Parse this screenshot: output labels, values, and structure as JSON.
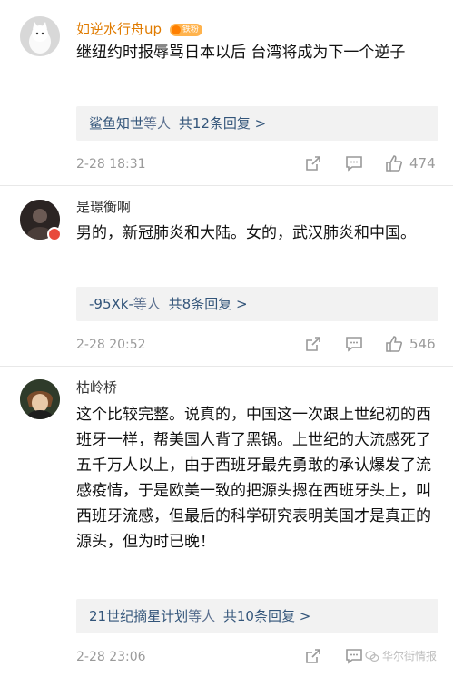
{
  "comments": [
    {
      "name": "如逆水行舟up",
      "name_color": "#e07b00",
      "badge": "铁粉",
      "text": "继纽约时报辱骂日本以后 台湾将成为下一个逆子",
      "reply_users": "鲨鱼知世",
      "reply_suffix": "等人",
      "reply_count": "共12条回复 >",
      "time": "2-28 18:31",
      "likes": "474"
    },
    {
      "name": "是璟衡啊",
      "name_color": "#333333",
      "text": "男的，新冠肺炎和大陆。女的，武汉肺炎和中国。",
      "reply_users": "-95Xk-",
      "reply_suffix": "等人",
      "reply_count": "共8条回复 >",
      "time": "2-28 20:52",
      "likes": "546"
    },
    {
      "name": "枯岭桥",
      "name_color": "#333333",
      "text": "这个比较完整。说真的，中国这一次跟上世纪初的西班牙一样，帮美国人背了黑锅。上世纪的大流感死了五千万人以上，由于西班牙最先勇敢的承认爆发了流感疫情，于是欧美一致的把源头摁在西班牙头上，叫西班牙流感，但最后的科学研究表明美国才是真正的源头，但为时已晚！",
      "reply_users": "21世纪摘星计划",
      "reply_suffix": "等人",
      "reply_count": "共10条回复 >",
      "time": "2-28 23:06",
      "likes": ""
    }
  ],
  "watermark": "华尔街情报"
}
